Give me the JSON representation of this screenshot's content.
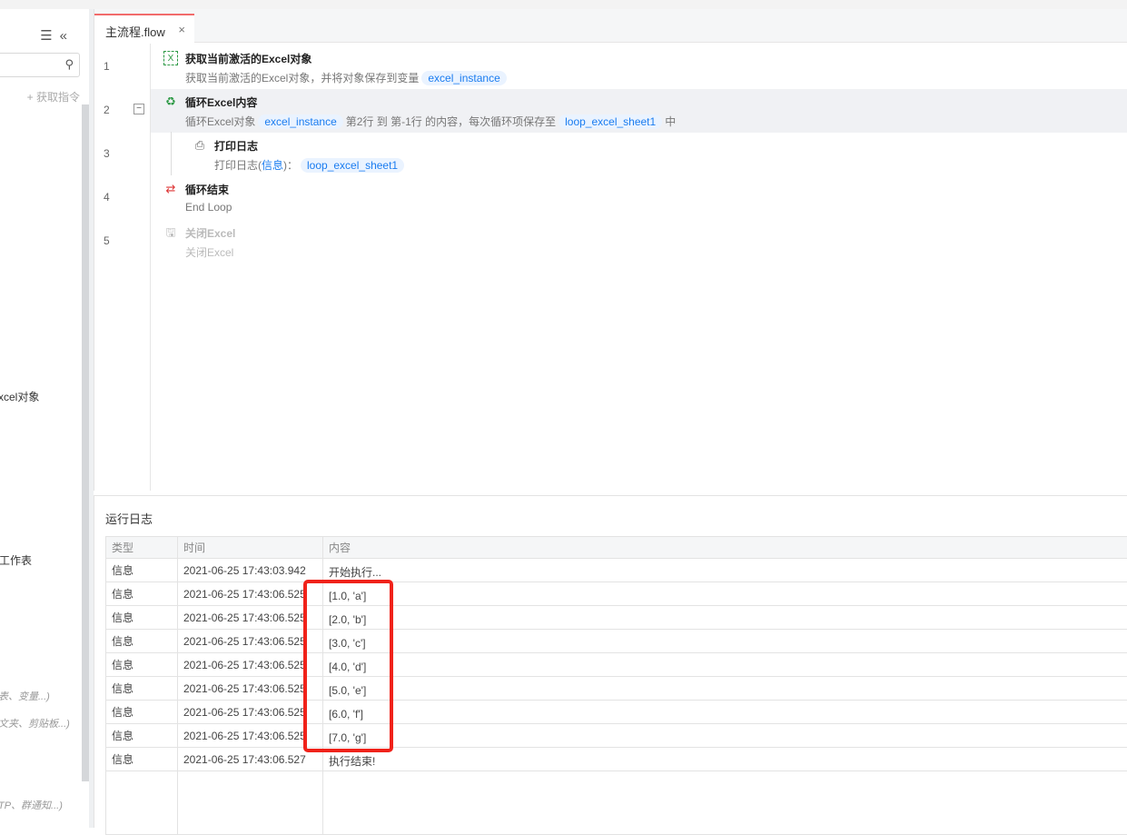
{
  "sidebar": {
    "get_commands": "+ 获取指令",
    "items": [
      "xcel对象",
      "工作表"
    ],
    "hints": [
      "表、变量...)",
      "文夹、剪贴板...)",
      "TP、群通知...)"
    ]
  },
  "tab": {
    "label": "主流程.flow",
    "close": "×"
  },
  "steps": [
    {
      "num": "1",
      "title": "获取当前激活的Excel对象",
      "desc": "获取当前激活的Excel对象，并将对象保存到变量",
      "var": "excel_instance"
    },
    {
      "num": "2",
      "title": "循环Excel内容",
      "d1": "循环Excel对象",
      "var1": "excel_instance",
      "d2": "第2行 到 第-1行 的内容，每次循环项保存至",
      "var2": "loop_excel_sheet1",
      "d3": "中"
    },
    {
      "num": "3",
      "title": "打印日志",
      "d1": "打印日志(",
      "level": "信息",
      "d2": ")：",
      "var": "loop_excel_sheet1"
    },
    {
      "num": "4",
      "title": "循环结束",
      "desc": "End Loop"
    },
    {
      "num": "5",
      "title": "关闭Excel",
      "desc": "关闭Excel"
    }
  ],
  "log": {
    "title": "运行日志",
    "columns": [
      "类型",
      "时间",
      "内容"
    ],
    "rows": [
      [
        "信息",
        "2021-06-25 17:43:03.942",
        "开始执行..."
      ],
      [
        "信息",
        "2021-06-25 17:43:06.525",
        "[1.0, 'a']"
      ],
      [
        "信息",
        "2021-06-25 17:43:06.525",
        "[2.0, 'b']"
      ],
      [
        "信息",
        "2021-06-25 17:43:06.525",
        "[3.0, 'c']"
      ],
      [
        "信息",
        "2021-06-25 17:43:06.525",
        "[4.0, 'd']"
      ],
      [
        "信息",
        "2021-06-25 17:43:06.525",
        "[5.0, 'e']"
      ],
      [
        "信息",
        "2021-06-25 17:43:06.525",
        "[6.0, 'f']"
      ],
      [
        "信息",
        "2021-06-25 17:43:06.525",
        "[7.0, 'g']"
      ],
      [
        "信息",
        "2021-06-25 17:43:06.527",
        "执行结束!"
      ]
    ]
  }
}
